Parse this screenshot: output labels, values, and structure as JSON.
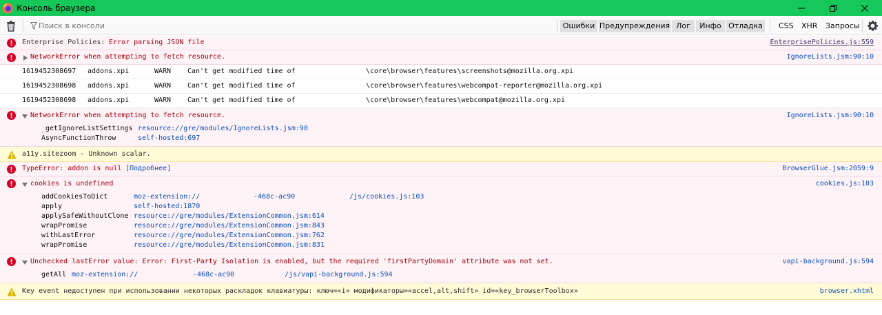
{
  "window": {
    "title": "Консоль браузера",
    "controls": [
      "minimize-icon",
      "restore-icon",
      "close-icon"
    ]
  },
  "toolbar": {
    "search_placeholder": "Поиск в консоли",
    "filters": [
      "Ошибки",
      "Предупреждения",
      "Лог",
      "Инфо",
      "Отладка"
    ],
    "extra_filters": [
      "CSS",
      "XHR",
      "Запросы"
    ]
  },
  "messages": [
    {
      "type": "error",
      "text": "Enterprise Policies: ",
      "text2": "Error parsing JSON file",
      "source": "EnterprisePolicies.js:559"
    },
    {
      "type": "error",
      "text": "NetworkError when attempting to fetch resource.",
      "source": "IgnoreLists.jsm:90:10",
      "twisty": "collapsed"
    },
    {
      "type": "log",
      "cells": [
        "1619452308697",
        "addons.xpi",
        "WARN",
        "Can't get modified time of",
        "\\core\\browser\\features\\screenshots@mozilla.org.xpi"
      ]
    },
    {
      "type": "log",
      "cells": [
        "1619452308698",
        "addons.xpi",
        "WARN",
        "Can't get modified time of",
        "\\core\\browser\\features\\webcompat-reporter@mozilla.org.xpi"
      ]
    },
    {
      "type": "log",
      "cells": [
        "1619452308698",
        "addons.xpi",
        "WARN",
        "Can't get modified time of",
        "\\core\\browser\\features\\webcompat@mozilla.org.xpi"
      ]
    },
    {
      "type": "error",
      "text": "NetworkError when attempting to fetch resource.",
      "source": "IgnoreLists.jsm:90:10",
      "twisty": "expanded",
      "frames": [
        {
          "fn": "_getIgnoreListSettings",
          "loc": "resource://gre/modules/IgnoreLists.jsm:90"
        },
        {
          "fn": "AsyncFunctionThrow",
          "loc": "self-hosted:697"
        }
      ]
    },
    {
      "type": "warn",
      "text": "a11y.sitezoom - Unknown scalar."
    },
    {
      "type": "error",
      "text": "TypeError: addon is null ",
      "more": "[Подробнее]",
      "source": "BrowserGlue.jsm:2059:9"
    },
    {
      "type": "error",
      "text": "cookies is undefined",
      "source": "cookies.js:103",
      "twisty": "expanded",
      "frames": [
        {
          "fn": "addCookiesToDict",
          "loc_a": "moz-extension://",
          "loc_b": "-468c-ac90",
          "loc_c": "/js/cookies.js:103"
        },
        {
          "fn": "apply",
          "loc": "self-hosted:1870"
        },
        {
          "fn": "applySafeWithoutClone",
          "loc": "resource://gre/modules/ExtensionCommon.jsm:614"
        },
        {
          "fn": "wrapPromise",
          "loc": "resource://gre/modules/ExtensionCommon.jsm:843"
        },
        {
          "fn": "withLastError",
          "loc": "resource://gre/modules/ExtensionCommon.jsm:762"
        },
        {
          "fn": "wrapPromise",
          "loc": "resource://gre/modules/ExtensionCommon.jsm:831"
        }
      ]
    },
    {
      "type": "error",
      "text": "Unchecked lastError value: Error: First-Party Isolation is enabled, but the required 'firstPartyDomain' attribute was not set.",
      "source": "vapi-background.js:594",
      "twisty": "expanded",
      "frames": [
        {
          "fn": "getAll",
          "loc_a": "moz-extension://",
          "loc_b": "-468c-ac90",
          "loc_c": "/js/vapi-background.js:594"
        }
      ]
    },
    {
      "type": "warn",
      "text": "Key event недоступен при использовании некоторых раскладок клавиатуры: ключ=«i» модификаторы=«accel,alt,shift» id=«key_browserToolbox»",
      "source": "browser.xhtml"
    }
  ]
}
